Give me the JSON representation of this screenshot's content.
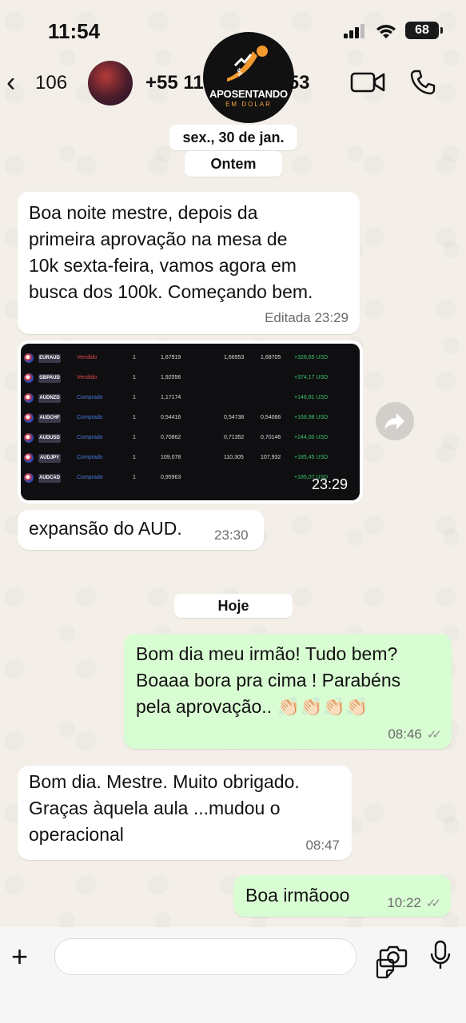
{
  "status_bar": {
    "time": "11:54",
    "battery": "68"
  },
  "header": {
    "back_count": "106",
    "contact": "+55 11 ",
    "contact_end": "553",
    "logo_title": "APOSENTANDO",
    "logo_subtitle": "EM DOLAR"
  },
  "chat": {
    "date_chip_1": "sex., 30 de jan.",
    "date_chip_2": "Ontem",
    "date_chip_3": "Hoje",
    "messages": [
      {
        "dir": "in",
        "text": "Boa noite mestre, depois da\nprimeira aprovação na mesa de\n10k sexta-feira, vamos agora em\nbusca dos 100k. Começando bem.",
        "meta": "Editada 23:29"
      },
      {
        "dir": "in",
        "type": "image",
        "meta": "23:29"
      },
      {
        "dir": "in",
        "text": "expansão do AUD.",
        "meta": "23:30"
      },
      {
        "dir": "out",
        "text": "Bom dia meu irmão! Tudo bem?\nBoaaa bora pra cima ! Parabéns\npela aprovação.. 👏🏻👏🏻👏🏻👏🏻",
        "meta": "08:46"
      },
      {
        "dir": "in",
        "text": "Bom dia. Mestre. Muito obrigado.\nGraças àquela aula ...mudou o\noperacional",
        "meta": "08:47"
      },
      {
        "dir": "out",
        "text": "Boa irmãooo",
        "meta": "10:22"
      }
    ]
  },
  "trades": [
    {
      "pair": "EURAUD",
      "side": "Vendido",
      "qty": "1",
      "p1": "1,67919",
      "p2": "1,66953",
      "p3": "1,68705",
      "pl": "+328,65 USD"
    },
    {
      "pair": "GBPAUD",
      "side": "Vendido",
      "qty": "1",
      "p1": "1,92556",
      "p2": "",
      "p3": "",
      "pl": "+374,17 USD"
    },
    {
      "pair": "AUDNZD",
      "side": "Comprado",
      "qty": "1",
      "p1": "1,17174",
      "p2": "",
      "p3": "",
      "pl": "+146,81 USD"
    },
    {
      "pair": "AUDCHF",
      "side": "Comprado",
      "qty": "1",
      "p1": "0,54416",
      "p2": "0,54738",
      "p3": "0,54066",
      "pl": "+168,98 USD"
    },
    {
      "pair": "AUDUSD",
      "side": "Comprado",
      "qty": "1",
      "p1": "0,70862",
      "p2": "0,71352",
      "p3": "0,70146",
      "pl": "+244,00 USD"
    },
    {
      "pair": "AUDJPY",
      "side": "Comprado",
      "qty": "1",
      "p1": "109,078",
      "p2": "110,305",
      "p3": "107,932",
      "pl": "+185,45 USD"
    },
    {
      "pair": "AUDCAD",
      "side": "Comprado",
      "qty": "1",
      "p1": "0,95963",
      "p2": "",
      "p3": "",
      "pl": "+185,07 USD"
    }
  ],
  "colors": {
    "incoming": "#ffffff",
    "outgoing": "#d9fdd3",
    "sell": "#e04848",
    "buy": "#4a7bd8",
    "profit": "#3cc46a"
  }
}
